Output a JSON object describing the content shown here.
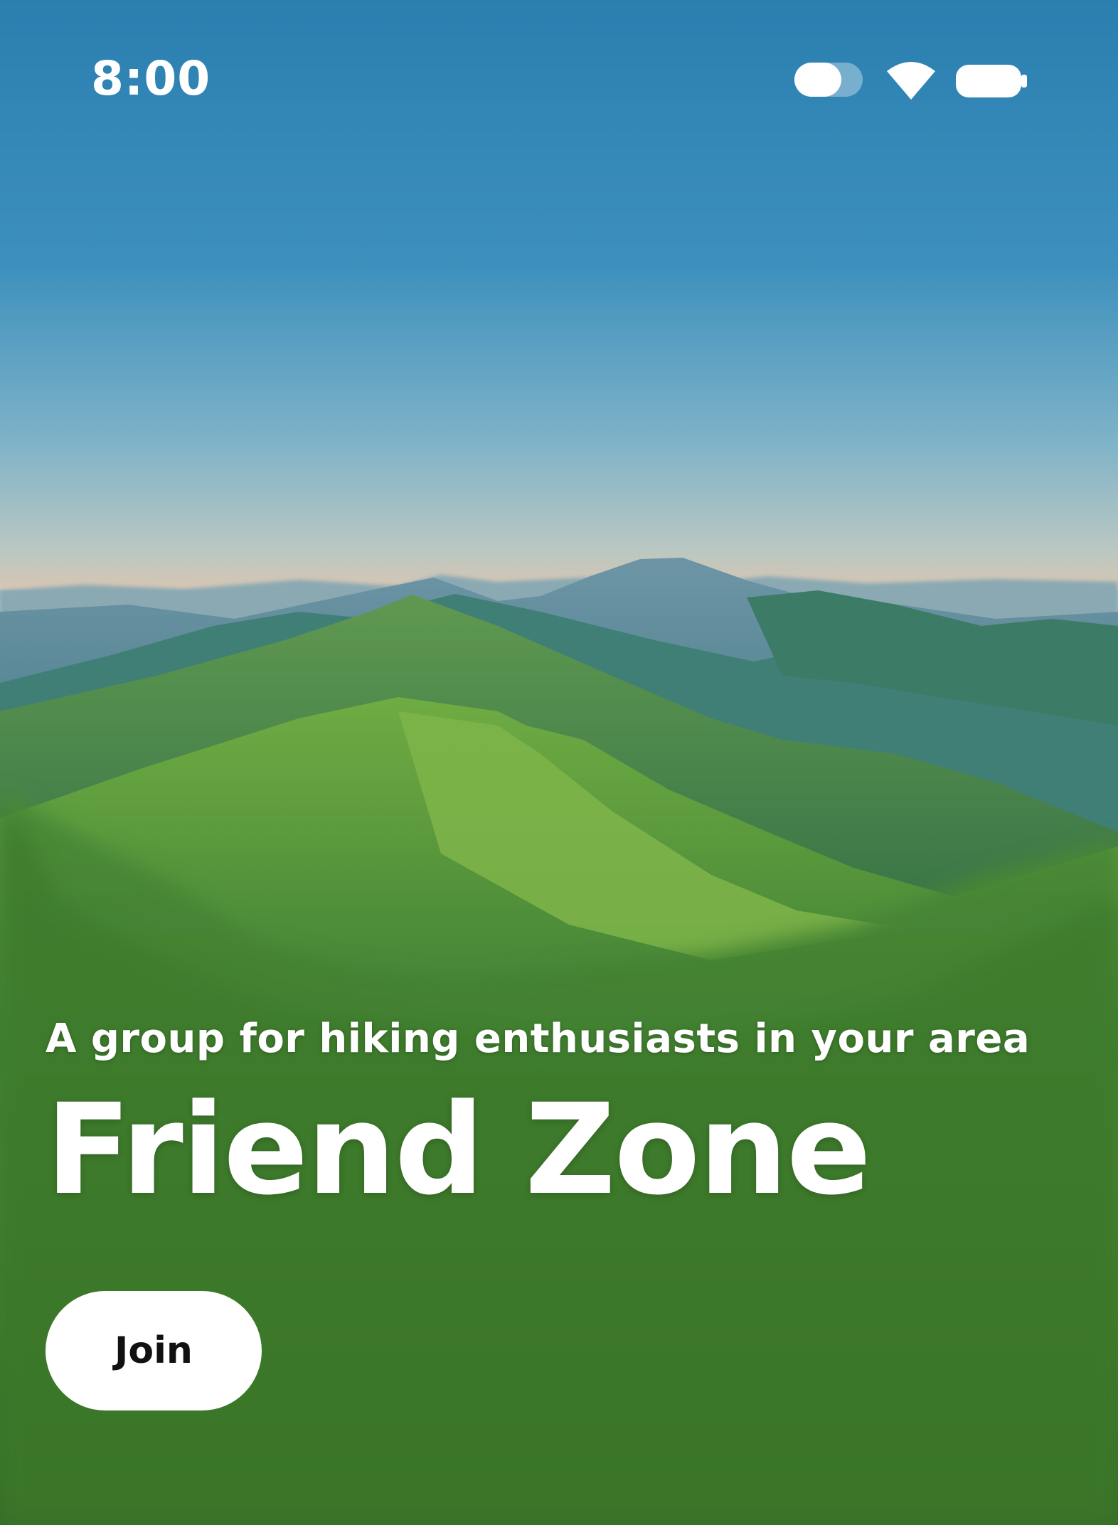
{
  "status_bar": {
    "time": "8:00",
    "icons": [
      "toggle-icon",
      "wifi-icon",
      "battery-icon"
    ]
  },
  "background": {
    "icon": "mountain-landscape-photo"
  },
  "hero": {
    "subtitle": "A group for hiking enthusiasts in your area",
    "title": "Friend Zone",
    "join_label": "Join"
  },
  "colors": {
    "text": "#ffffff",
    "button_background": "#ffffff",
    "button_text": "#111111"
  }
}
